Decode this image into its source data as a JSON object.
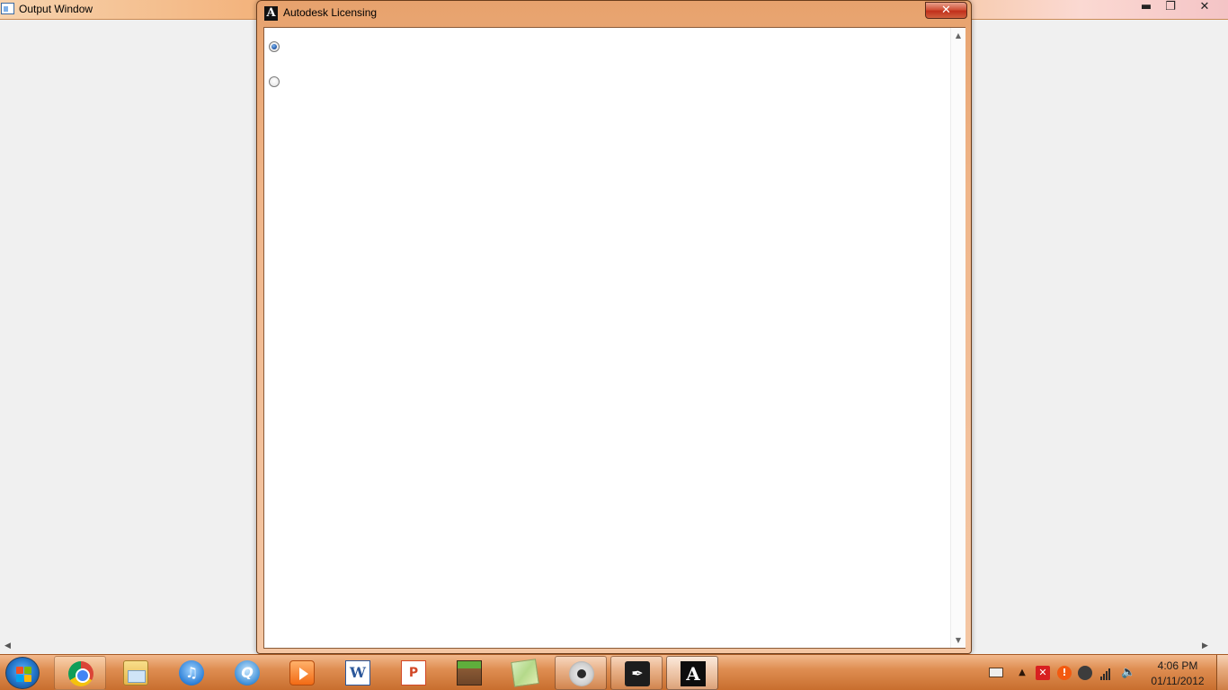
{
  "background_window": {
    "title": "Output Window",
    "controls": {
      "minimize": "▬",
      "maximize": "❐",
      "close": "✕"
    },
    "scroll_left_glyph": "◀",
    "scroll_right_glyph": "▶"
  },
  "dialog": {
    "title": "Autodesk Licensing",
    "app_icon_letter": "A",
    "close_glyph": "✕",
    "radios": [
      {
        "selected": true
      },
      {
        "selected": false
      }
    ],
    "scroll_up_glyph": "▲",
    "scroll_down_glyph": "▼"
  },
  "taskbar": {
    "items": [
      {
        "name": "chrome-icon",
        "state": "pinned"
      },
      {
        "name": "windows-explorer-icon",
        "state": "pinned"
      },
      {
        "name": "itunes-icon",
        "state": "pinned",
        "glyph": "♫"
      },
      {
        "name": "quicktime-icon",
        "state": "pinned",
        "glyph": "Q"
      },
      {
        "name": "media-player-icon",
        "state": "pinned"
      },
      {
        "name": "word-icon",
        "state": "pinned",
        "glyph": "W"
      },
      {
        "name": "powerpoint-icon",
        "state": "pinned",
        "glyph": "P"
      },
      {
        "name": "minecraft-icon",
        "state": "pinned"
      },
      {
        "name": "map-icon",
        "state": "pinned"
      },
      {
        "name": "steam-icon",
        "state": "running"
      },
      {
        "name": "inkscape-icon",
        "state": "running",
        "glyph": "✒"
      },
      {
        "name": "autodesk-icon",
        "state": "active",
        "glyph": "A"
      }
    ],
    "tray": {
      "expand_glyph": "▲",
      "error_glyph": "✕",
      "warning_glyph": "!",
      "volume_glyph": "🔈"
    },
    "clock": {
      "time": "4:06 PM",
      "date": "01/11/2012"
    }
  },
  "colors": {
    "aero_accent": "#ef9a56",
    "close_red": "#c1301b",
    "radio_selected": "#2a5fae"
  }
}
